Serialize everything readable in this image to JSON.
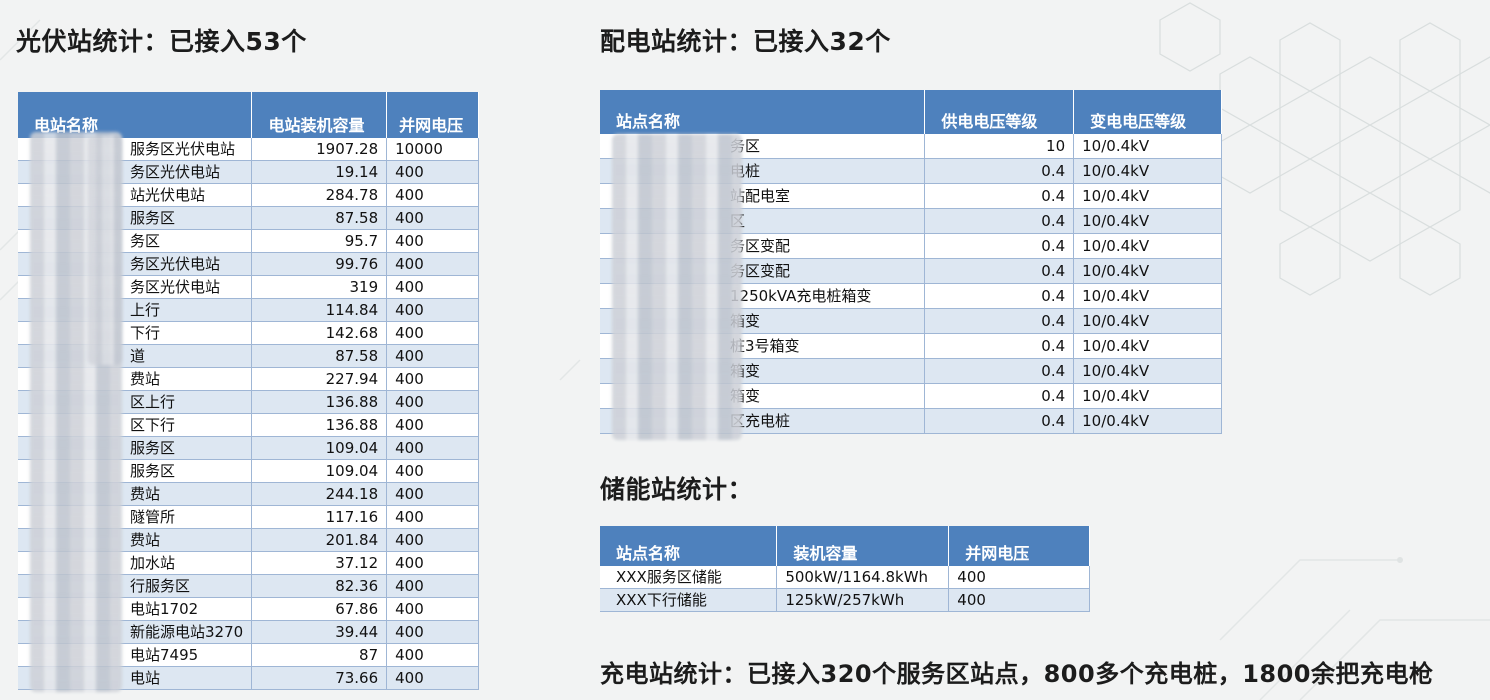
{
  "pv": {
    "title": "光伏站统计：已接入53个",
    "columns": [
      "电站名称",
      "电站装机容量",
      "并网电压"
    ],
    "rows": [
      [
        "服务区光伏电站",
        "1907.28",
        "10000"
      ],
      [
        "务区光伏电站",
        "19.14",
        "400"
      ],
      [
        "站光伏电站",
        "284.78",
        "400"
      ],
      [
        "服务区",
        "87.58",
        "400"
      ],
      [
        "务区",
        "95.7",
        "400"
      ],
      [
        "务区光伏电站",
        "99.76",
        "400"
      ],
      [
        "务区光伏电站",
        "319",
        "400"
      ],
      [
        "上行",
        "114.84",
        "400"
      ],
      [
        "下行",
        "142.68",
        "400"
      ],
      [
        "道",
        "87.58",
        "400"
      ],
      [
        "费站",
        "227.94",
        "400"
      ],
      [
        "区上行",
        "136.88",
        "400"
      ],
      [
        "区下行",
        "136.88",
        "400"
      ],
      [
        "服务区",
        "109.04",
        "400"
      ],
      [
        "服务区",
        "109.04",
        "400"
      ],
      [
        "费站",
        "244.18",
        "400"
      ],
      [
        "隧管所",
        "117.16",
        "400"
      ],
      [
        "费站",
        "201.84",
        "400"
      ],
      [
        "加水站",
        "37.12",
        "400"
      ],
      [
        "行服务区",
        "82.36",
        "400"
      ],
      [
        "电站1702",
        "67.86",
        "400"
      ],
      [
        "新能源电站3270",
        "39.44",
        "400"
      ],
      [
        "电站7495",
        "87",
        "400"
      ],
      [
        "电站",
        "73.66",
        "400"
      ]
    ]
  },
  "dist": {
    "title": "配电站统计：已接入32个",
    "columns": [
      "站点名称",
      "供电电压等级",
      "变电电压等级"
    ],
    "rows": [
      [
        "务区",
        "10",
        "10/0.4kV"
      ],
      [
        "电桩",
        "0.4",
        "10/0.4kV"
      ],
      [
        "站配电室",
        "0.4",
        "10/0.4kV"
      ],
      [
        "区",
        "0.4",
        "10/0.4kV"
      ],
      [
        "务区变配",
        "0.4",
        "10/0.4kV"
      ],
      [
        "务区变配",
        "0.4",
        "10/0.4kV"
      ],
      [
        "1250kVA充电桩箱变",
        "0.4",
        "10/0.4kV"
      ],
      [
        "箱变",
        "0.4",
        "10/0.4kV"
      ],
      [
        "桩3号箱变",
        "0.4",
        "10/0.4kV"
      ],
      [
        "箱变",
        "0.4",
        "10/0.4kV"
      ],
      [
        "箱变",
        "0.4",
        "10/0.4kV"
      ],
      [
        "区充电桩",
        "0.4",
        "10/0.4kV"
      ]
    ]
  },
  "storage": {
    "title": "储能站统计：",
    "columns": [
      "站点名称",
      "装机容量",
      "并网电压"
    ],
    "rows": [
      [
        "XXX服务区储能",
        "500kW/1164.8kWh",
        "400"
      ],
      [
        "XXX下行储能",
        "125kW/257kWh",
        "400"
      ]
    ]
  },
  "charging": {
    "title": "充电站统计：已接入320个服务区站点，800多个充电桩，1800余把充电枪"
  },
  "colors": {
    "header_blue": "#4e81bd",
    "row_alt": "#dde7f2",
    "background": "#f2f3f3"
  }
}
